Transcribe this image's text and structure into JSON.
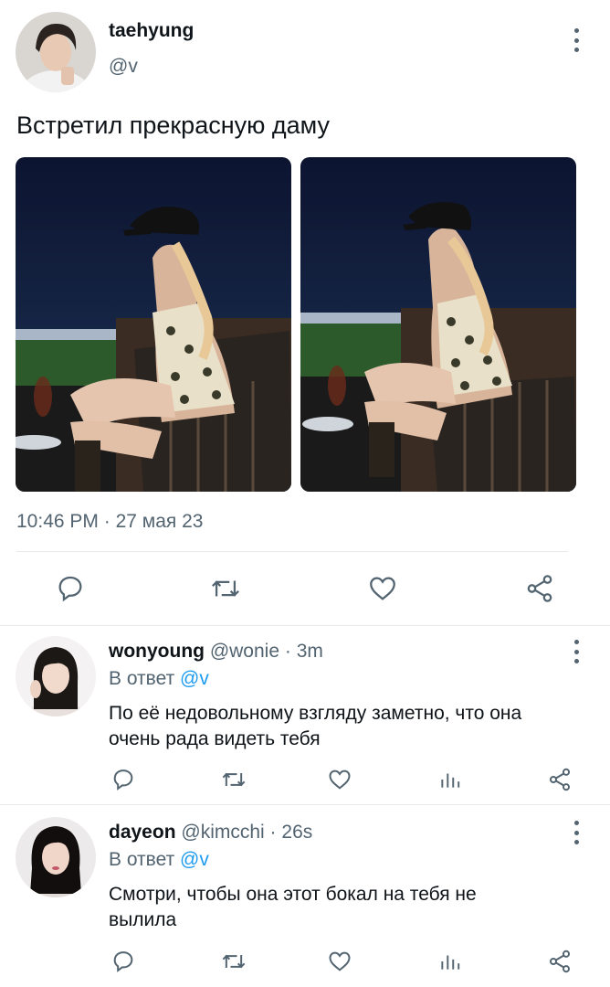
{
  "tweet": {
    "author_name": "taehyung",
    "author_handle": "@v",
    "text": "Встретил прекрасную даму",
    "time": "10:46 PM",
    "dot": "·",
    "date": "27 мая 23",
    "icons": [
      "reply-icon",
      "retweet-icon",
      "like-icon",
      "share-icon"
    ]
  },
  "replies": [
    {
      "name": "wonyoung",
      "handle": "@wonie",
      "sep": "·",
      "time": "3m",
      "reply_to_label": "В ответ",
      "reply_to_handle": "@v",
      "text_line1": "По её недовольному взгляду заметно, что она",
      "text_line2": "очень рада видеть тебя"
    },
    {
      "name": "dayeon",
      "handle": "@kimcchi",
      "sep": "·",
      "time": "26s",
      "reply_to_label": "В ответ",
      "reply_to_handle": "@v",
      "text_line1": "Смотри, чтобы она этот бокал на тебя не",
      "text_line2": "вылила"
    }
  ],
  "colors": {
    "link": "#1d9bf0",
    "muted": "#536471",
    "divider": "#e7e9ea"
  }
}
